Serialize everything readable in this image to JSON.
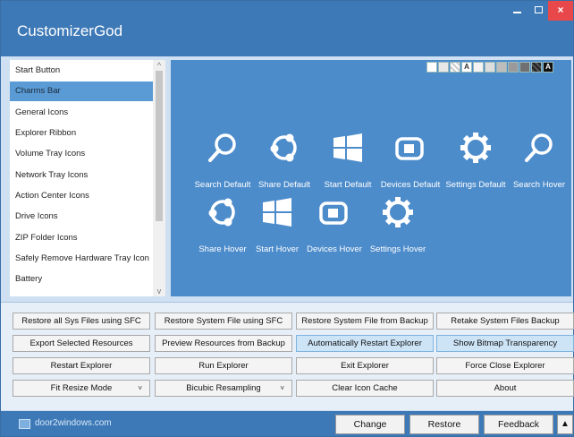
{
  "window": {
    "title": "CustomizerGod",
    "close_glyph": "×"
  },
  "sidebar": {
    "items": [
      {
        "label": "Start Button"
      },
      {
        "label": "Charms Bar",
        "selected": true
      },
      {
        "label": "General Icons"
      },
      {
        "label": "Explorer Ribbon"
      },
      {
        "label": "Volume Tray Icons"
      },
      {
        "label": "Network Tray Icons"
      },
      {
        "label": "Action Center Icons"
      },
      {
        "label": "Drive Icons"
      },
      {
        "label": "ZIP Folder Icons"
      },
      {
        "label": "Safely Remove Hardware Tray Icon"
      },
      {
        "label": "Battery"
      }
    ],
    "scroll_up": "^",
    "scroll_down": "v"
  },
  "swatches": {
    "light": [
      "#ffffff",
      "#e8e8e8",
      "checker",
      "A",
      "#f3f3f3",
      "#dddddd"
    ],
    "dark": [
      "#bdbdbd",
      "#9a9a9a",
      "#707070",
      "checker",
      "A"
    ],
    "a_glyph": "A"
  },
  "icons": [
    {
      "label": "Search Default",
      "icon": "search-icon"
    },
    {
      "label": "Share Default",
      "icon": "share-icon"
    },
    {
      "label": "Start Default",
      "icon": "windows-logo-icon"
    },
    {
      "label": "Devices Default",
      "icon": "devices-icon"
    },
    {
      "label": "Settings Default",
      "icon": "gear-icon"
    },
    {
      "label": "Search Hover",
      "icon": "search-icon"
    },
    {
      "label": "Share Hover",
      "icon": "share-icon"
    },
    {
      "label": "Start Hover",
      "icon": "windows-logo-icon"
    },
    {
      "label": "Devices Hover",
      "icon": "devices-icon"
    },
    {
      "label": "Settings Hover",
      "icon": "gear-icon"
    }
  ],
  "buttons": {
    "restore_all_sfc": "Restore all Sys Files using SFC",
    "restore_sfc": "Restore System File using SFC",
    "restore_backup": "Restore System File from Backup",
    "retake_backup": "Retake System Files Backup",
    "export_selected": "Export Selected Resources",
    "preview_backup": "Preview Resources from Backup",
    "auto_restart": "Automatically Restart Explorer",
    "show_transparency": "Show Bitmap Transparency",
    "restart_explorer": "Restart Explorer",
    "run_explorer": "Run Explorer",
    "exit_explorer": "Exit Explorer",
    "force_close": "Force Close Explorer",
    "resize_mode": "Fit Resize Mode",
    "resampling": "Bicubic Resampling",
    "clear_cache": "Clear Icon Cache",
    "about": "About",
    "dropdown_caret": "˅"
  },
  "statusbar": {
    "site": "door2windows.com",
    "change": "Change",
    "restore": "Restore",
    "feedback": "Feedback",
    "expand": "▲"
  },
  "colors": {
    "titlebar": "#3e79b7",
    "icon_panel": "#4d8ccb",
    "selected_item": "#5b9bd5",
    "close_button": "#e8484a"
  }
}
